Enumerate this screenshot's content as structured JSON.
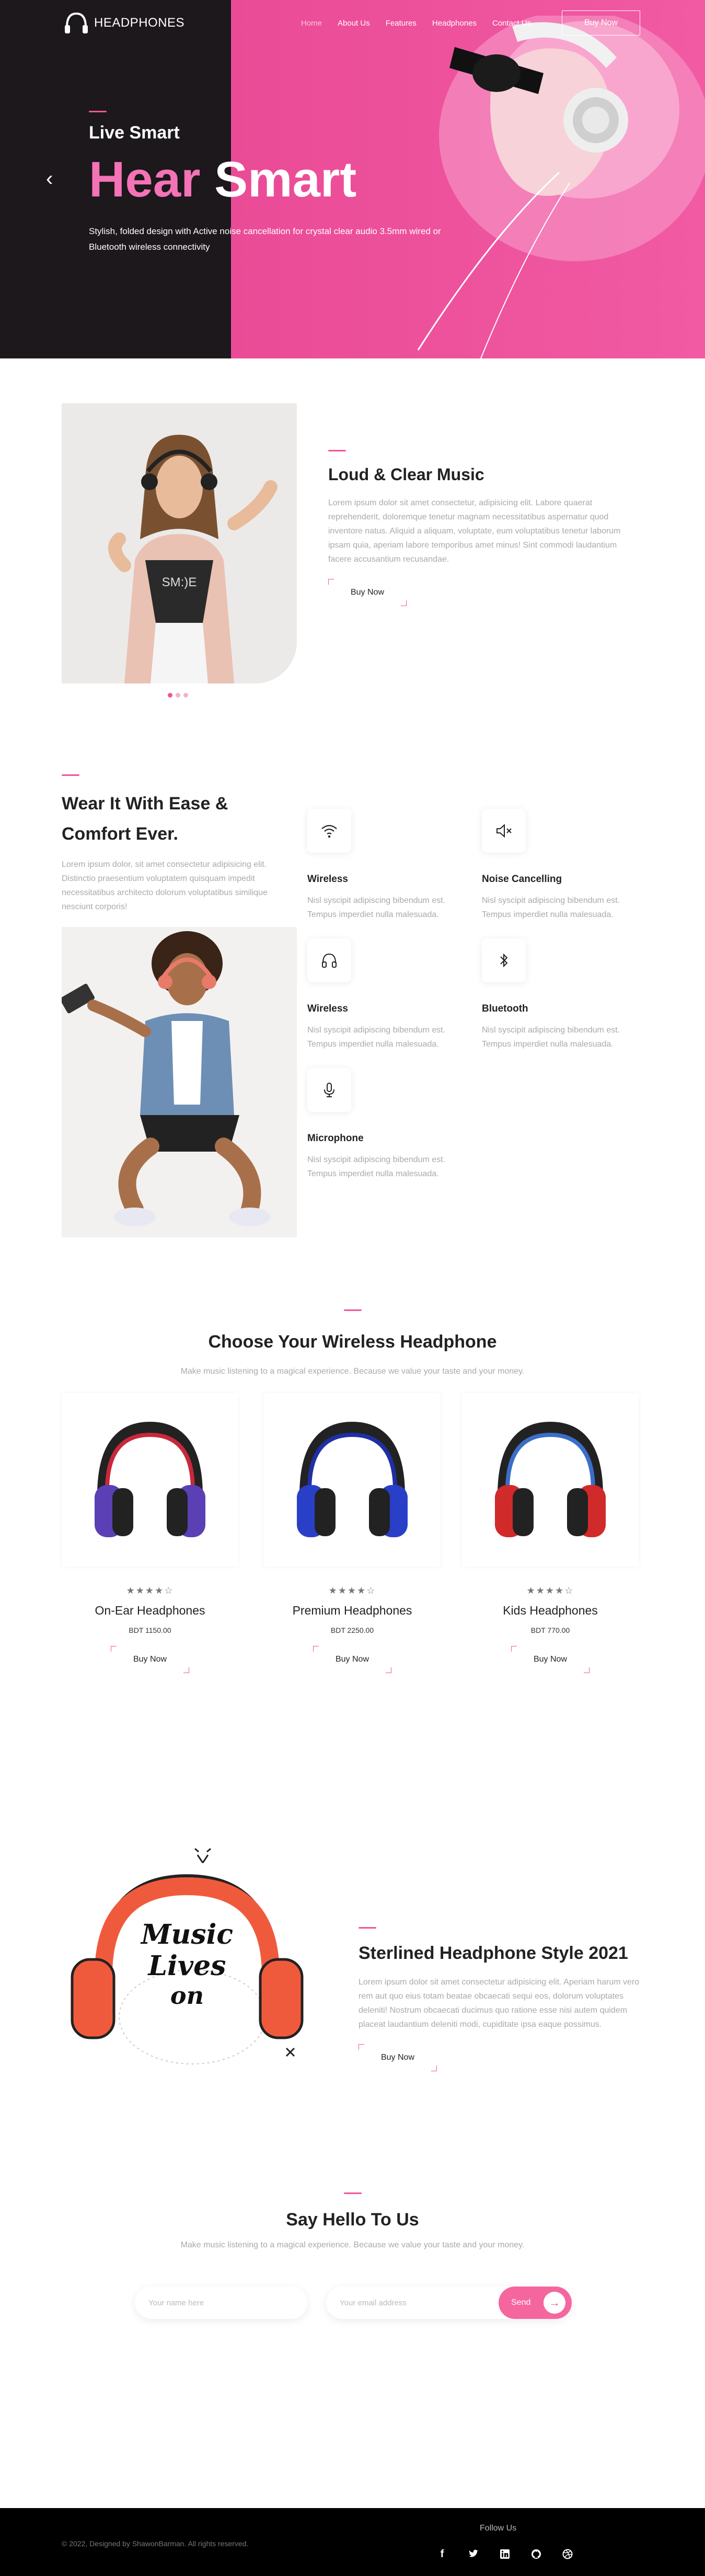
{
  "brand": {
    "logo_text": "HEADPHONES"
  },
  "nav": {
    "links": [
      "Home",
      "About Us",
      "Features",
      "Headphones",
      "Contact Us"
    ],
    "cta": "Buy Now"
  },
  "hero": {
    "subtitle": "Live Smart",
    "title_pink": "Hear",
    "title_white": "Smart",
    "description": "Stylish, folded design with Active noise cancellation for crystal clear audio 3.5mm wired or Bluetooth wireless connectivity"
  },
  "about": {
    "title": "Loud & Clear Music",
    "body": "Lorem ipsum dolor sit amet consectetur, adipisicing elit. Labore quaerat reprehenderit, doloremque tenetur magnam necessitatibus aspernatur quod inventore natus. Aliquid a aliquam, voluptate, eum voluptatibus tenetur laborum ipsam quia, aperiam labore temporibus amet minus! Sint commodi laudantium facere accusantium recusandae.",
    "button": "Buy Now",
    "image_tshirt_text": "SM:)E"
  },
  "features": {
    "title": "Wear It With Ease & Comfort Ever.",
    "body": "Lorem ipsum dolor, sit amet consectetur adipisicing elit. Distinctio praesentium voluptatem quisquam impedit necessitatibus architecto dolorum voluptatibus similique nesciunt corporis!",
    "items": [
      {
        "title": "Wireless",
        "icon": "wifi-icon",
        "text": "Nisl syscipit adipiscing bibendum est. Tempus imperdiet nulla malesuada."
      },
      {
        "title": "Noise Cancelling",
        "icon": "speaker-mute-icon",
        "text": "Nisl syscipit adipiscing bibendum est. Tempus imperdiet nulla malesuada."
      },
      {
        "title": "Wireless",
        "icon": "headphone-icon",
        "text": "Nisl syscipit adipiscing bibendum est. Tempus imperdiet nulla malesuada."
      },
      {
        "title": "Bluetooth",
        "icon": "bluetooth-icon",
        "text": "Nisl syscipit adipiscing bibendum est. Tempus imperdiet nulla malesuada."
      },
      {
        "title": "Microphone",
        "icon": "microphone-icon",
        "text": "Nisl syscipit adipiscing bibendum est. Tempus imperdiet nulla malesuada."
      }
    ]
  },
  "products": {
    "title": "Choose Your Wireless Headphone",
    "subtitle": "Make music listening to a magical experience. Because we value your taste and your money.",
    "items": [
      {
        "name": "On-Ear Headphones",
        "price": "BDT 1150.00",
        "rating": "★★★★☆",
        "button": "Buy Now",
        "colors": {
          "band": "#c8283a",
          "cup": "#5b3fb5",
          "pad": "#222"
        }
      },
      {
        "name": "Premium Headphones",
        "price": "BDT 2250.00",
        "rating": "★★★★☆",
        "button": "Buy Now",
        "colors": {
          "band": "#1f2fa5",
          "cup": "#2a3fc8",
          "pad": "#222"
        }
      },
      {
        "name": "Kids Headphones",
        "price": "BDT 770.00",
        "rating": "★★★★☆",
        "button": "Buy Now",
        "colors": {
          "band": "#3a6ec8",
          "cup": "#d12a2a",
          "pad": "#222"
        }
      }
    ]
  },
  "style": {
    "title": "Sterlined Headphone Style 2021",
    "body": "Lorem ipsum dolor sit amet consectetur adipisicing elit. Aperiam harum vero rem aut quo eius totam beatae obcaecati sequi eos, dolorum voluptates deleniti! Nostrum obcaecati ducimus quo ratione esse nisi autem quidem placeat laudantium deleniti modi, cupiditate ipsa eaque possimus.",
    "button": "Buy Now",
    "art_text": [
      "Music",
      "Lives",
      "on"
    ]
  },
  "contact": {
    "title": "Say Hello To Us",
    "subtitle": "Make music listening to a magical experience. Because we value your taste and your money.",
    "name_placeholder": "Your name here",
    "email_placeholder": "Your email address",
    "send": "Send"
  },
  "footer": {
    "copyright": "© 2022, Designed by ShawonBarman. All rights reserved.",
    "follow": "Follow Us",
    "socials": [
      "facebook-icon",
      "twitter-icon",
      "linkedin-icon",
      "github-icon",
      "dribbble-icon"
    ]
  },
  "colors": {
    "accent": "#f2549b",
    "hero_dark": "#1c181b",
    "hero_pink": "#ea4b96"
  }
}
